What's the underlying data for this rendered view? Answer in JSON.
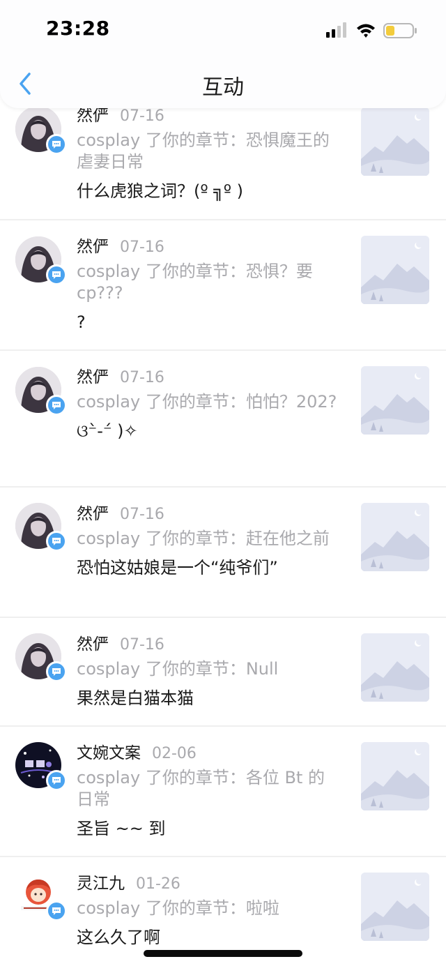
{
  "status_bar": {
    "time": "23:28"
  },
  "nav": {
    "title": "互动"
  },
  "items": [
    {
      "name": "然俨",
      "date": "07-16",
      "action": "cosplay 了你的章节：恐惧魔王的虐妻日常",
      "comment": "什么虎狼之词？(º ╗º )"
    },
    {
      "name": "然俨",
      "date": "07-16",
      "action": "cosplay 了你的章节：恐惧？要cp???",
      "comment": "?"
    },
    {
      "name": "然俨",
      "date": "07-16",
      "action": "cosplay 了你的章节：怕怕？202?",
      "comment": "ଓ⁻̀-⁻́ )✧"
    },
    {
      "name": "然俨",
      "date": "07-16",
      "action": "cosplay 了你的章节：赶在他之前",
      "comment": "恐怕这姑娘是一个“纯爷们”"
    },
    {
      "name": "然俨",
      "date": "07-16",
      "action": "cosplay 了你的章节：Null",
      "comment": "果然是白猫本猫"
    },
    {
      "name": "文婉文案",
      "date": "02-06",
      "action": "cosplay 了你的章节：各位 Bt 的日常",
      "comment": "圣旨 ~~ 到"
    },
    {
      "name": "灵江九",
      "date": "01-26",
      "action": "cosplay 了你的章节：啦啦",
      "comment": "这么久了啊"
    }
  ],
  "icons": {
    "back": "chevron-left-icon",
    "badge": "chat-bubble-icon",
    "thumb": "mountain-placeholder-icon"
  },
  "colors": {
    "accent": "#4aa3f0",
    "muted": "#a9a9ad",
    "battery": "#f3cc3c"
  }
}
